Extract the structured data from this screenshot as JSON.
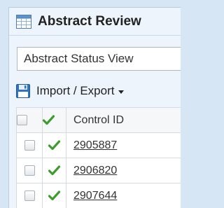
{
  "panel": {
    "title": "Abstract Review",
    "icon": "table-icon"
  },
  "view_select": {
    "value": "Abstract Status View"
  },
  "toolbar": {
    "import_export_label": "Import / Export",
    "icon": "floppy-disk-icon"
  },
  "table": {
    "columns": {
      "select": "",
      "status": "check-icon",
      "control_id": "Control ID"
    },
    "rows": [
      {
        "control_id": "2905887"
      },
      {
        "control_id": "2906820"
      },
      {
        "control_id": "2907644"
      }
    ]
  },
  "colors": {
    "page_bg": "#d6e6f5",
    "panel_bg": "#eef4fb",
    "check_green": "#3f9b2f"
  }
}
